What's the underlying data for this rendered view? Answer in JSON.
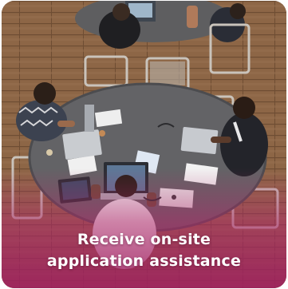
{
  "card": {
    "caption_line1": "Receive on-site",
    "caption_line2": "application assistance",
    "overlay_color": "#b0266a",
    "caption_color": "#ffffff"
  }
}
